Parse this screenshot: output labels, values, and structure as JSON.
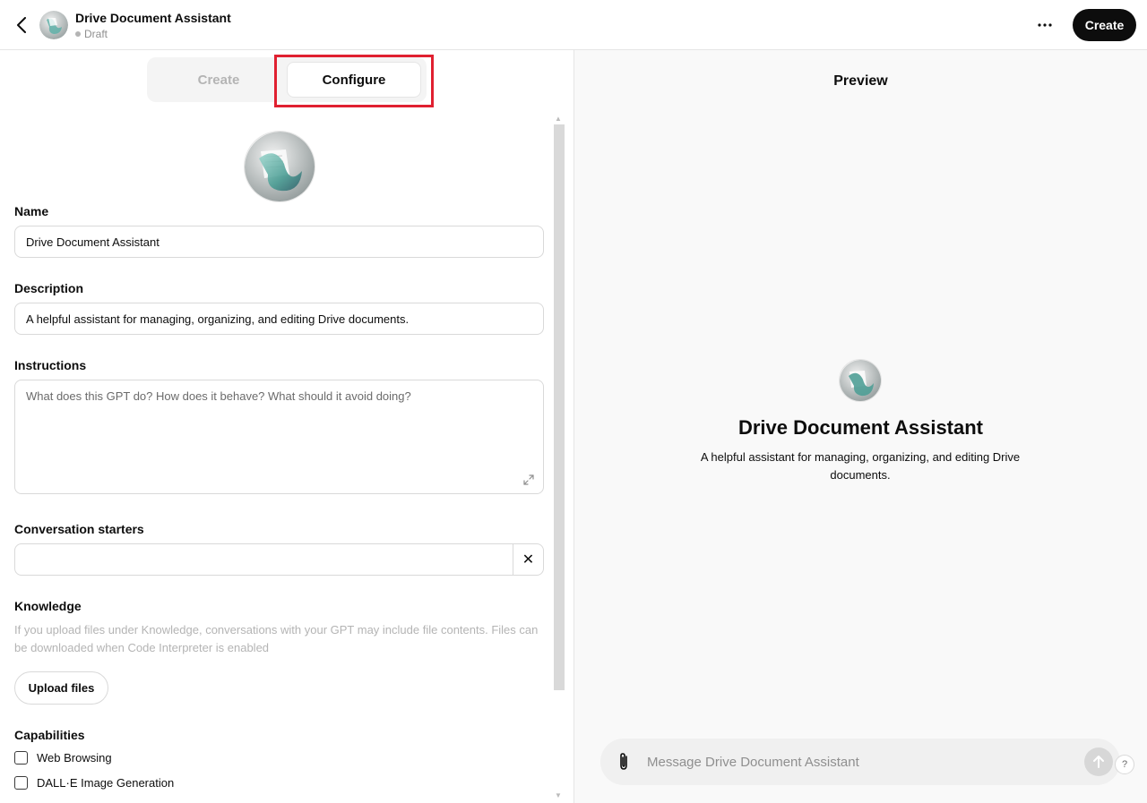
{
  "header": {
    "title": "Drive Document Assistant",
    "status": "Draft",
    "more_label": "···",
    "create_label": "Create"
  },
  "tabs": {
    "create_label": "Create",
    "configure_label": "Configure",
    "active": "Configure"
  },
  "form": {
    "name": {
      "label": "Name",
      "value": "Drive Document Assistant"
    },
    "description": {
      "label": "Description",
      "value": "A helpful assistant for managing, organizing, and editing Drive documents."
    },
    "instructions": {
      "label": "Instructions",
      "placeholder": "What does this GPT do? How does it behave? What should it avoid doing?"
    },
    "conversation_starters": {
      "label": "Conversation starters",
      "value": "",
      "remove_label": "✕"
    },
    "knowledge": {
      "label": "Knowledge",
      "note": "If you upload files under Knowledge, conversations with your GPT may include file contents. Files can be downloaded when Code Interpreter is enabled",
      "upload_label": "Upload files"
    },
    "capabilities": {
      "label": "Capabilities",
      "items": [
        {
          "label": "Web Browsing",
          "checked": false
        },
        {
          "label": "DALL·E Image Generation",
          "checked": false
        }
      ]
    }
  },
  "preview": {
    "title": "Preview",
    "gpt_name": "Drive Document Assistant",
    "gpt_description": "A helpful assistant for managing, organizing, and editing Drive documents.",
    "composer_placeholder": "Message Drive Document Assistant",
    "help_label": "?"
  },
  "icons": {
    "back": "chevron-left-icon",
    "more": "ellipsis-icon",
    "expand": "expand-icon",
    "close": "close-icon",
    "attach": "paperclip-icon",
    "send": "arrow-up-icon"
  },
  "colors": {
    "highlight": "#e02030",
    "primary_button": "#0d0d0d",
    "preview_bg": "#f9f9f9"
  }
}
